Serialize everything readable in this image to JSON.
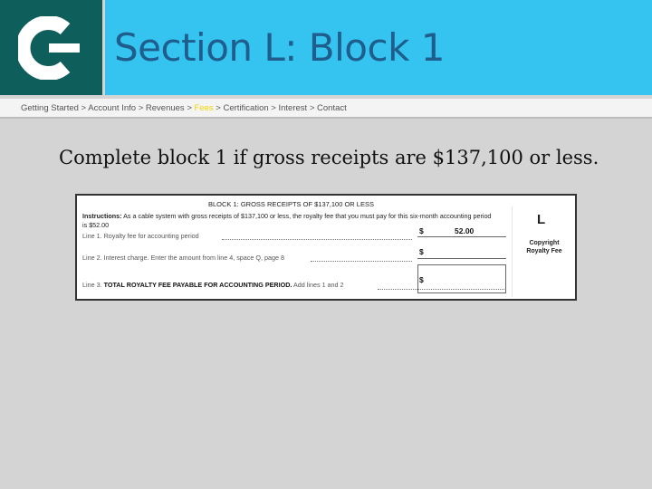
{
  "header": {
    "title": "Section L: Block 1",
    "logo_icon": "copyright-c-icon",
    "logo_color": "#0e5f5c",
    "title_bar_color": "#35c3f0",
    "title_color": "#1f5d8c"
  },
  "breadcrumb": {
    "items": [
      "Getting Started",
      "Account Info",
      "Revenues",
      "Fees",
      "Certification",
      "Interest",
      "Contact"
    ],
    "separator": ">",
    "active": "Fees",
    "active_color": "#f2d600"
  },
  "headline": "Complete block 1 if gross receipts are $137,100 or less.",
  "form": {
    "title": "BLOCK 1: GROSS RECEIPTS OF $137,100 OR LESS",
    "instructions_label": "Instructions:",
    "instructions_text": "As a cable system with gross receipts of $137,100 or less, the royalty fee that you must pay for this six-month accounting period is $52.00",
    "line1": "Line 1. Royalty fee for accounting period",
    "line2": "Line 2. Interest charge. Enter the amount from line 4, space Q, page 8",
    "line3_prefix": "Line 3.",
    "line3_bold": "TOTAL ROYALTY FEE PAYABLE FOR ACCOUNTING PERIOD.",
    "line3_suffix": "Add lines 1 and 2",
    "currency_symbol": "$",
    "line1_amount": "52.00",
    "side_letter": "L",
    "side_label_1": "Copyright",
    "side_label_2": "Royalty Fee"
  }
}
